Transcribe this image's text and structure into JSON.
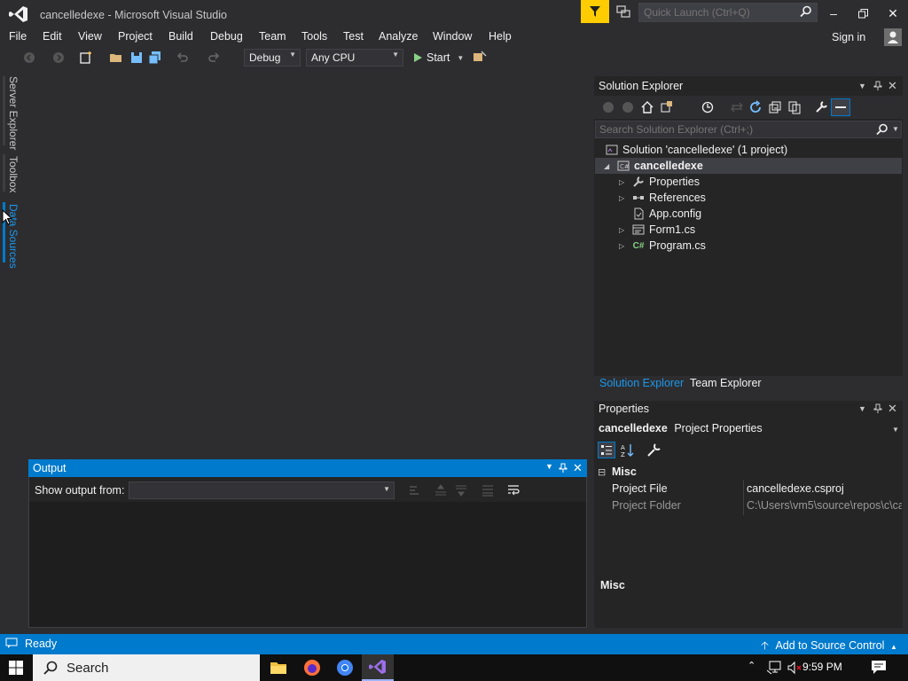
{
  "window": {
    "title": "cancelledexe - Microsoft Visual Studio",
    "quick_launch_placeholder": "Quick Launch (Ctrl+Q)",
    "sign_in": "Sign in"
  },
  "menu": [
    "File",
    "Edit",
    "View",
    "Project",
    "Build",
    "Debug",
    "Team",
    "Tools",
    "Test",
    "Analyze",
    "Window",
    "Help"
  ],
  "toolbar": {
    "config": "Debug",
    "platform": "Any CPU",
    "start": "Start"
  },
  "left_rail": [
    "Server Explorer",
    "Toolbox",
    "Data Sources"
  ],
  "solution_explorer": {
    "title": "Solution Explorer",
    "search_placeholder": "Search Solution Explorer (Ctrl+;)",
    "tree": [
      {
        "label": "Solution 'cancelledexe' (1 project)",
        "icon": "solution-icon"
      },
      {
        "label": "cancelledexe",
        "icon": "csharp-project-icon",
        "selected": true
      },
      {
        "label": "Properties",
        "icon": "wrench-icon"
      },
      {
        "label": "References",
        "icon": "references-icon"
      },
      {
        "label": "App.config",
        "icon": "config-file-icon"
      },
      {
        "label": "Form1.cs",
        "icon": "form-icon"
      },
      {
        "label": "Program.cs",
        "icon": "csharp-file-icon"
      }
    ],
    "tabs": [
      "Solution Explorer",
      "Team Explorer"
    ]
  },
  "properties": {
    "title": "Properties",
    "object_name": "cancelledexe",
    "object_type": "Project Properties",
    "category": "Misc",
    "rows": [
      {
        "name": "Project File",
        "value": "cancelledexe.csproj"
      },
      {
        "name": "Project Folder",
        "value": "C:\\Users\\vm5\\source\\repos\\c\\ca"
      }
    ],
    "description_title": "Misc"
  },
  "output": {
    "title": "Output",
    "show_output_from": "Show output from:"
  },
  "status": {
    "ready": "Ready",
    "source_control": "Add to Source Control"
  },
  "taskbar": {
    "search": "Search",
    "time": "9:59 PM"
  },
  "colors": {
    "accent": "#007acc",
    "filter": "#ffcc00",
    "bg": "#2d2d30"
  }
}
